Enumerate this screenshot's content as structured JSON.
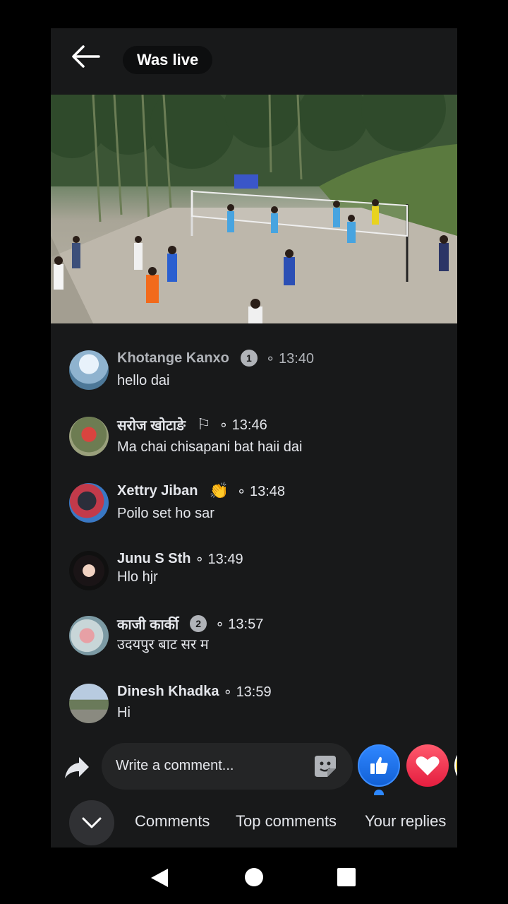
{
  "header": {
    "live_label": "Was live"
  },
  "comments": [
    {
      "name": "Khotange Kanxo",
      "badge": "1",
      "time": "13:40",
      "text": "hello  dai",
      "dim": true
    },
    {
      "name": "सरोज खोटाङे",
      "flag": "⚐",
      "time": "13:46",
      "text": "Ma chai chisapani bat haii dai",
      "dim": false
    },
    {
      "name": "Xettry Jiban",
      "flag": "👏",
      "time": "13:48",
      "text": "Poilo set ho sar",
      "dim": false
    },
    {
      "name": "Junu S Sth",
      "time": "13:49",
      "text": "Hlo hjr",
      "dim": false
    },
    {
      "name": "काजी कार्की",
      "badge": "2",
      "time": "13:57",
      "text": "उदयपुर बाट सर म",
      "dim": false
    },
    {
      "name": "Dinesh Khadka",
      "time": "13:59",
      "text": "Hi",
      "dim": false
    }
  ],
  "composer": {
    "placeholder": "Write a comment..."
  },
  "tabs": [
    "Comments",
    "Top comments",
    "Your replies"
  ],
  "colors": {
    "background": "#18191a",
    "like": "#1877f2",
    "love": "#f33e58"
  },
  "icons": [
    "back-arrow-icon",
    "share-icon",
    "sticker-icon",
    "like-icon",
    "heart-icon",
    "chevron-down-icon"
  ]
}
